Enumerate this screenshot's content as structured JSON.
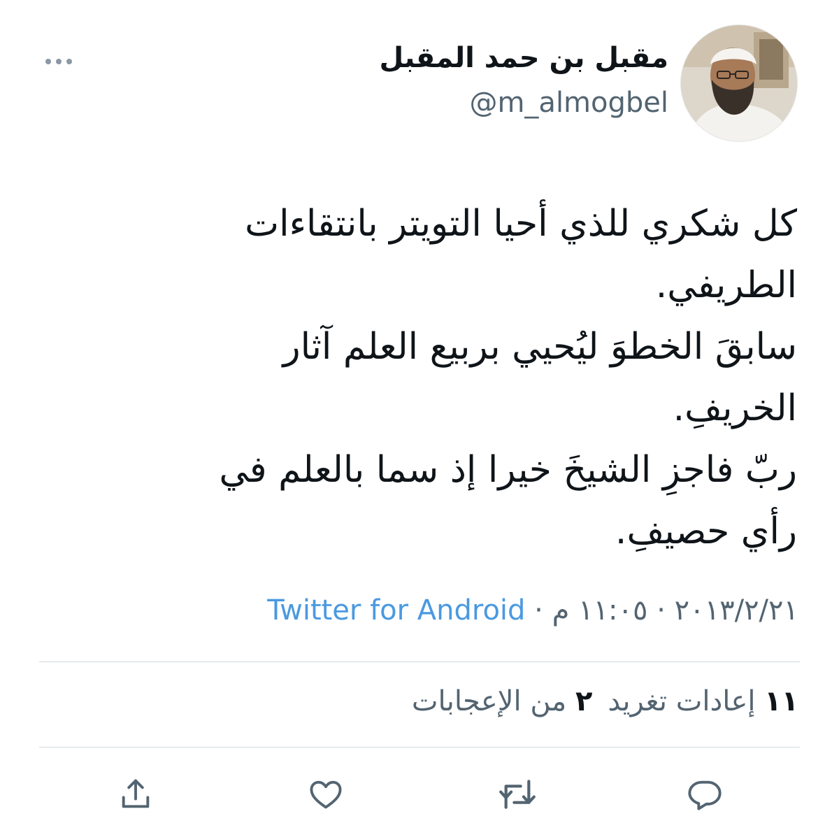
{
  "user": {
    "display_name": "مقبل بن حمد المقبل",
    "handle": "@m_almogbel"
  },
  "tweet": {
    "lines": [
      "كل شكري للذي أحيا التويتر بانتقاءات",
      "الطريفي.",
      "سابقَ الخطوَ ليُحيي بربيع العلم آثار",
      "الخريفِ.",
      "ربّ فاجزِ الشيخَ خيرا إذ سما بالعلم في",
      "رأي حصيفِ."
    ]
  },
  "meta": {
    "date": "٢٠١٣/٢/٢١",
    "separator": "·",
    "time": "١١:٠٥ م",
    "source": "Twitter for Android"
  },
  "stats": {
    "retweets_count": "١١",
    "retweets_label": "إعادات تغريد",
    "likes_count": "٢",
    "likes_label": "من الإعجابات"
  },
  "icons": {
    "more": "more-horizontal-icon",
    "reply": "reply-icon",
    "retweet": "retweet-icon",
    "like": "like-icon",
    "share": "share-icon"
  },
  "colors": {
    "text": "#0f1419",
    "secondary": "#536471",
    "link": "#4a99e0",
    "icon": "#536471",
    "divider": "#cfd9de"
  }
}
